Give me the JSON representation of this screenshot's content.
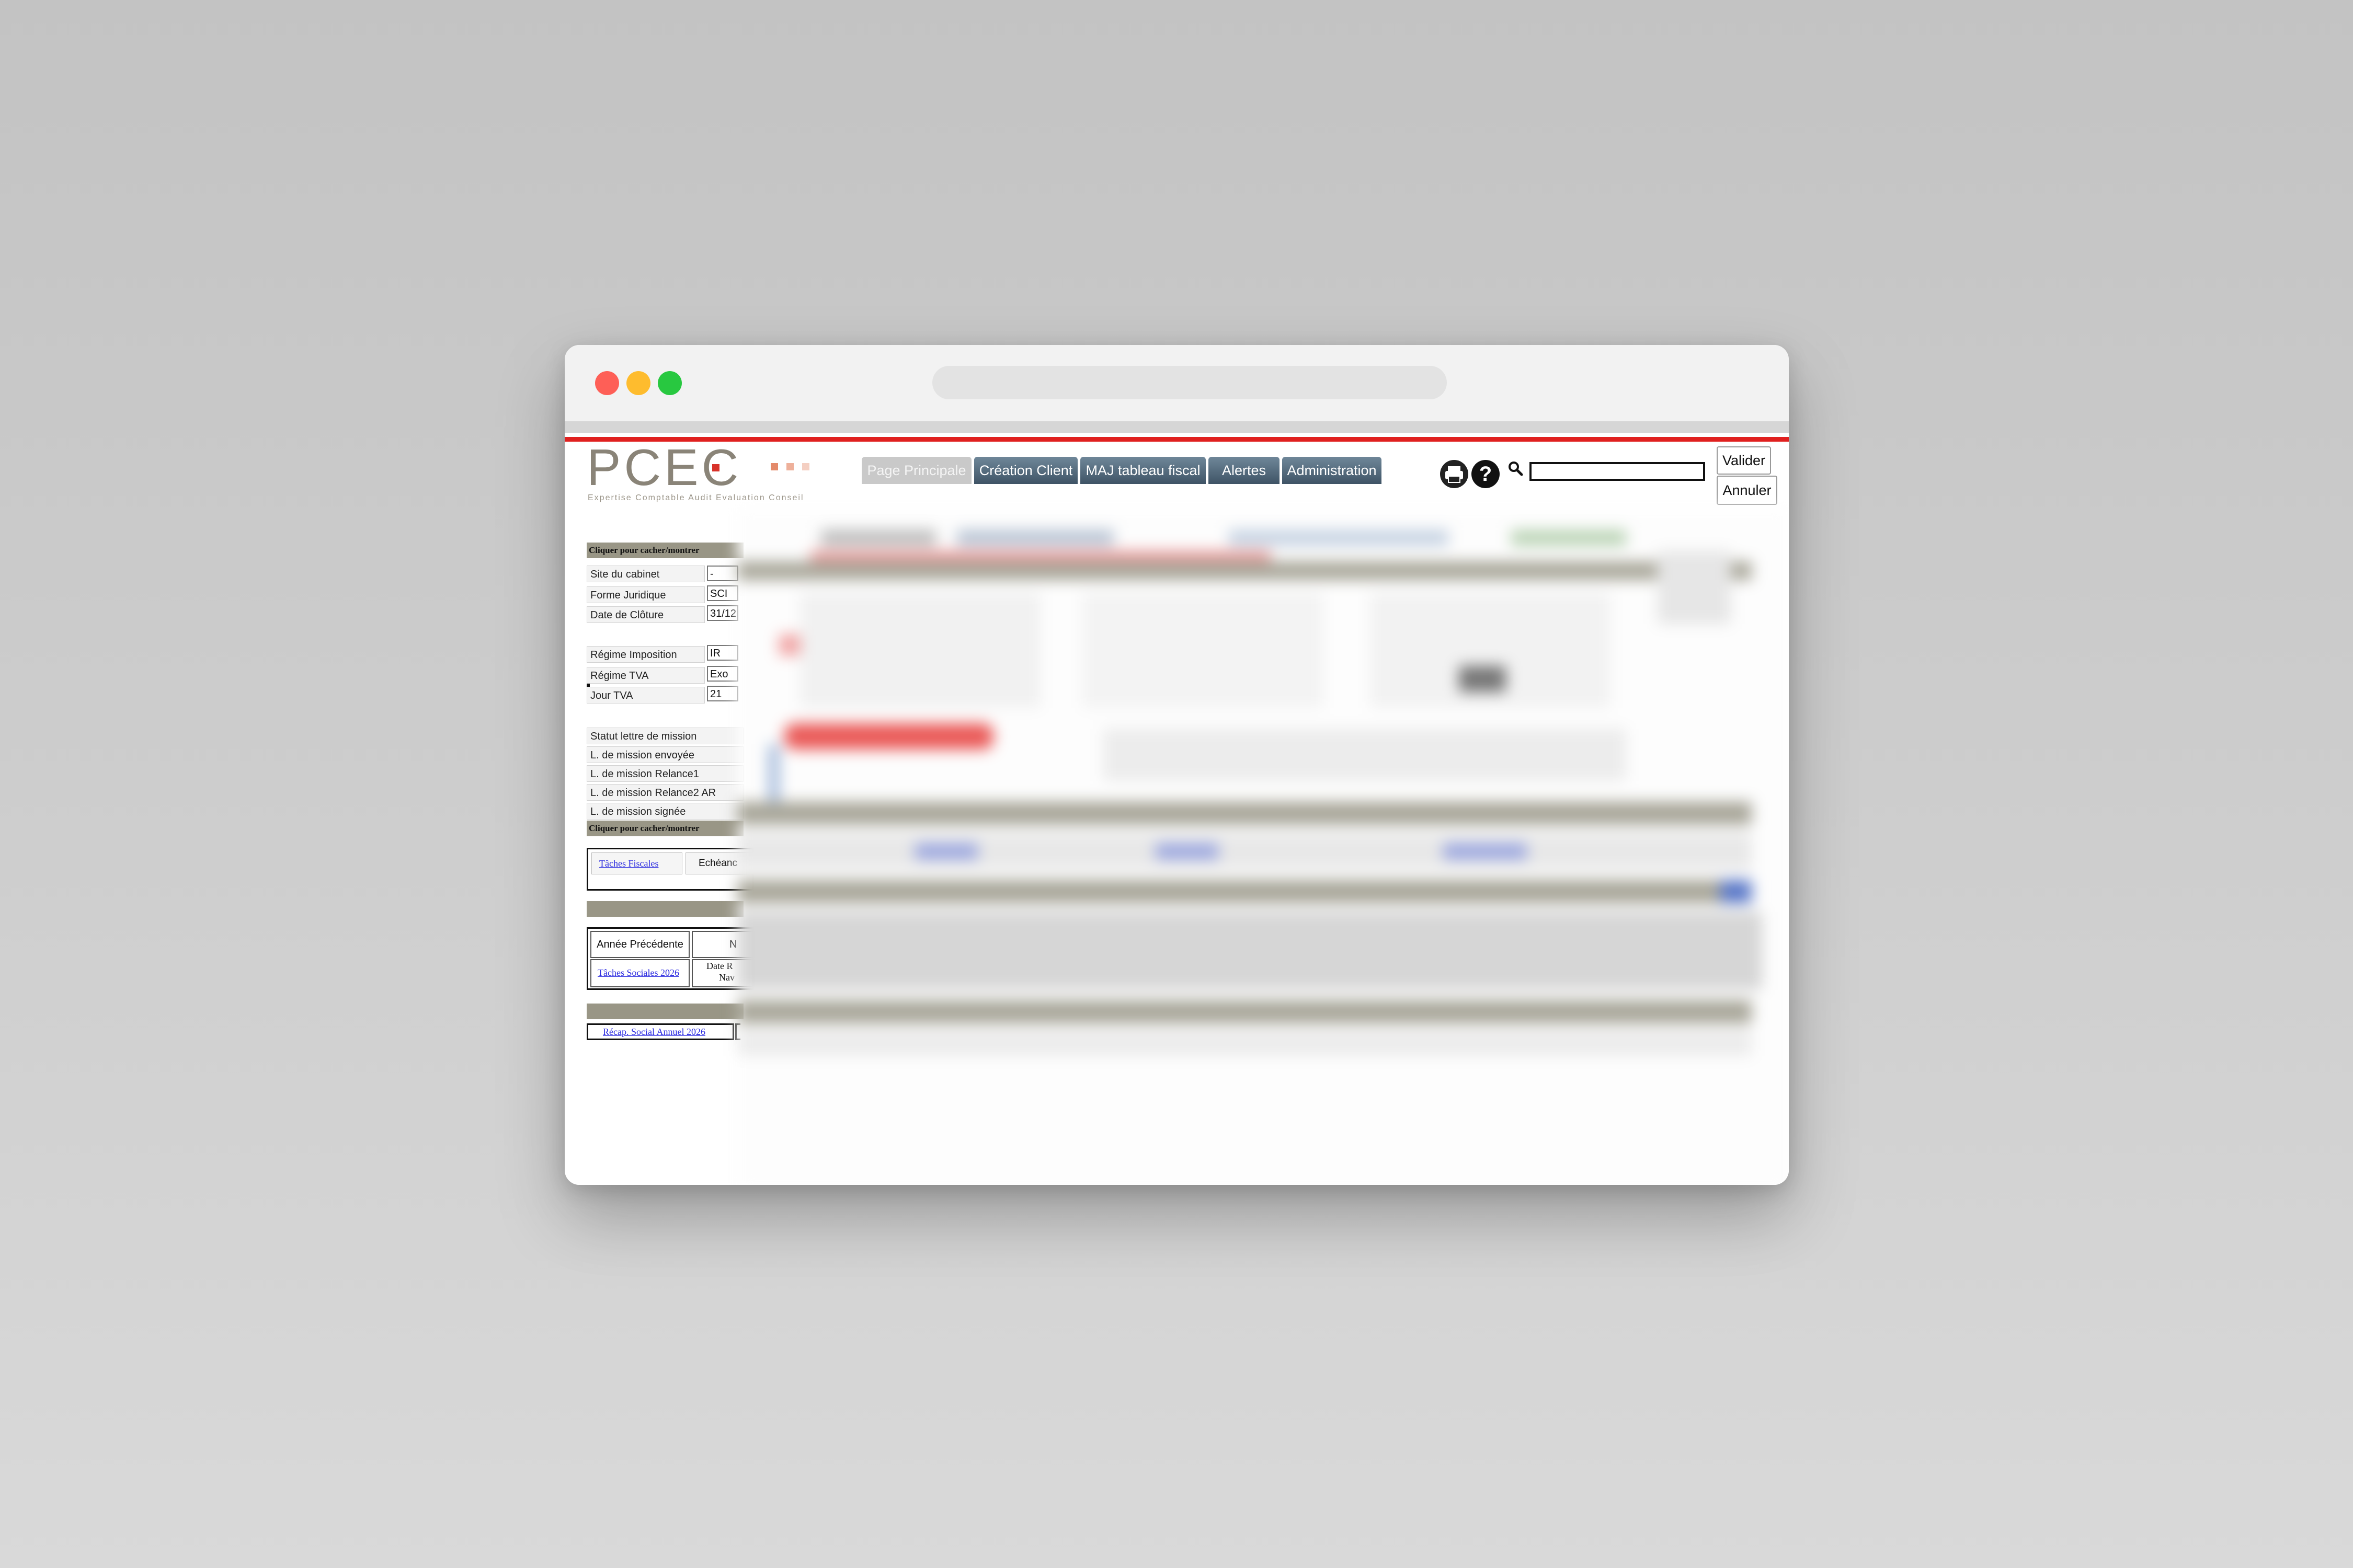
{
  "logo": {
    "text": "PCEC",
    "tagline": "Expertise Comptable Audit Evaluation Conseil"
  },
  "nav": {
    "tabs": [
      {
        "label": "Page Principale",
        "active": true
      },
      {
        "label": "Création Client",
        "active": false
      },
      {
        "label": "MAJ tableau fiscal",
        "active": false
      },
      {
        "label": "Alertes",
        "active": false
      },
      {
        "label": "Administration",
        "active": false
      }
    ]
  },
  "toolbar": {
    "print_icon": "printer-icon",
    "help_icon": "help-icon",
    "search_icon": "search-icon",
    "search_value": "",
    "valider_label": "Valider",
    "annuler_label": "Annuler"
  },
  "panel": {
    "toggle_label": "Cliquer pour cacher/montrer",
    "fields": [
      {
        "label": "Site du cabinet",
        "value": "-"
      },
      {
        "label": "Forme Juridique",
        "value": "SCI"
      },
      {
        "label": "Date de Clôture",
        "value": "31/12"
      }
    ],
    "tax_fields": [
      {
        "label": "Régime Imposition",
        "value": "IR"
      },
      {
        "label": "Régime TVA",
        "value": "Exo"
      },
      {
        "label": "Jour TVA",
        "value": "21"
      }
    ],
    "mission_fields": [
      {
        "label": "Statut lettre de mission"
      },
      {
        "label": "L. de mission envoyée"
      },
      {
        "label": "L. de mission Relance1"
      },
      {
        "label": "L. de mission Relance2 AR"
      },
      {
        "label": "L. de mission signée"
      }
    ],
    "toggle_label_2": "Cliquer pour cacher/montrer",
    "taches_fiscales_link": "Tâches Fiscales",
    "echeance_label": "Echéanc",
    "annee_precedente_label": "Année Précédente",
    "na_label": "N",
    "taches_sociales_link": "Tâches Sociales 2026",
    "date_label": "Date R",
    "nav_label": "Nav",
    "recap_link": "Récap. Social Annuel 2026"
  }
}
